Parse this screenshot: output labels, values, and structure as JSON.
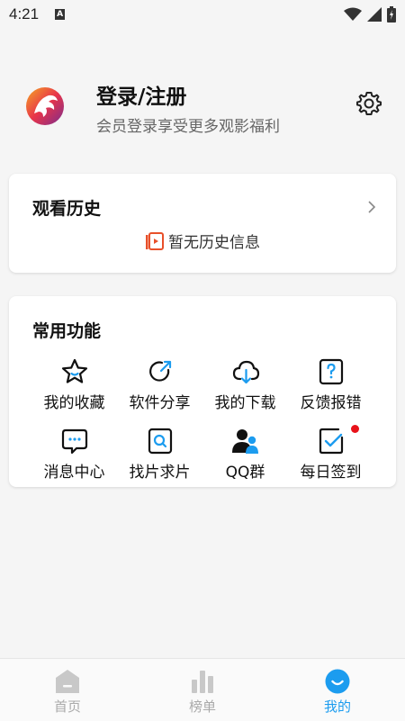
{
  "status_bar": {
    "time": "4:21",
    "notification_letter": "A"
  },
  "profile": {
    "title": "登录/注册",
    "subtitle": "会员登录享受更多观影福利"
  },
  "history": {
    "title": "观看历史",
    "empty_text": "暂无历史信息"
  },
  "functions": {
    "title": "常用功能",
    "items": [
      {
        "label": "我的收藏",
        "icon": "star-icon"
      },
      {
        "label": "软件分享",
        "icon": "share-icon"
      },
      {
        "label": "我的下载",
        "icon": "cloud-download-icon"
      },
      {
        "label": "反馈报错",
        "icon": "question-icon"
      },
      {
        "label": "消息中心",
        "icon": "message-icon"
      },
      {
        "label": "找片求片",
        "icon": "search-icon"
      },
      {
        "label": "QQ群",
        "icon": "group-icon"
      },
      {
        "label": "每日签到",
        "icon": "checkin-icon"
      }
    ]
  },
  "bottom_nav": {
    "items": [
      {
        "label": "首页",
        "icon": "home-icon"
      },
      {
        "label": "榜单",
        "icon": "chart-icon"
      },
      {
        "label": "我的",
        "icon": "smile-icon"
      }
    ],
    "active_color": "#1c9cef"
  }
}
